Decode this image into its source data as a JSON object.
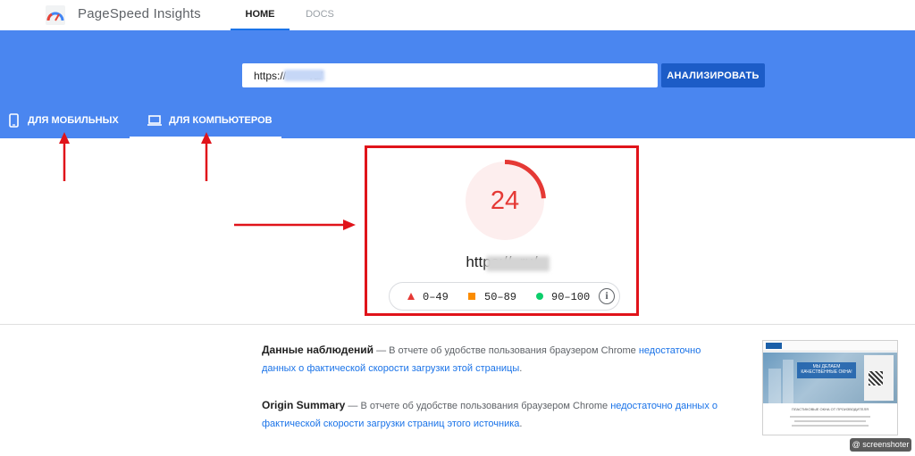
{
  "app": {
    "title": "PageSpeed Insights"
  },
  "nav": {
    "home": "HOME",
    "docs": "DOCS"
  },
  "search": {
    "url_value": "https://        ru/",
    "button_label": "АНАЛИЗИРОВАТЬ"
  },
  "device_tabs": {
    "mobile": "ДЛЯ МОБИЛЬНЫХ",
    "desktop": "ДЛЯ КОМПЬЮТЕРОВ",
    "selected": "desktop"
  },
  "score": {
    "value": "24",
    "fraction": 0.24,
    "tested_url": "https://            .ru/",
    "color": "#e53935"
  },
  "legend": {
    "poor": "0–49",
    "average": "50–89",
    "good": "90–100"
  },
  "field_data": {
    "title": "Данные наблюдений",
    "dash": "— В отчете об удобстве пользования браузером Chrome ",
    "link": "недостаточно данных о фактической скорости загрузки этой страницы",
    "end": "."
  },
  "origin_summary": {
    "title": "Origin Summary",
    "dash": "— В отчете об удобстве пользования браузером Chrome ",
    "link": "недостаточно данных о фактической скорости загрузки страниц этого источника",
    "end": "."
  },
  "thumbnail": {
    "banner_text": "МЫ ДЕЛАЕМ КАЧЕСТВЕННЫЕ ОКНА!",
    "caption": "ПЛАСТИКОВЫЕ ОКНА ОТ ПРОИЗВОДИТЕЛЯ"
  },
  "watermark": {
    "text": "@ screenshoter"
  },
  "colors": {
    "brand_blue": "#4a86f0",
    "button_blue": "#1c5cc7",
    "highlight_red": "#e0131a",
    "poor": "#e53935",
    "average": "#fb8c00",
    "good": "#0cce6b"
  }
}
